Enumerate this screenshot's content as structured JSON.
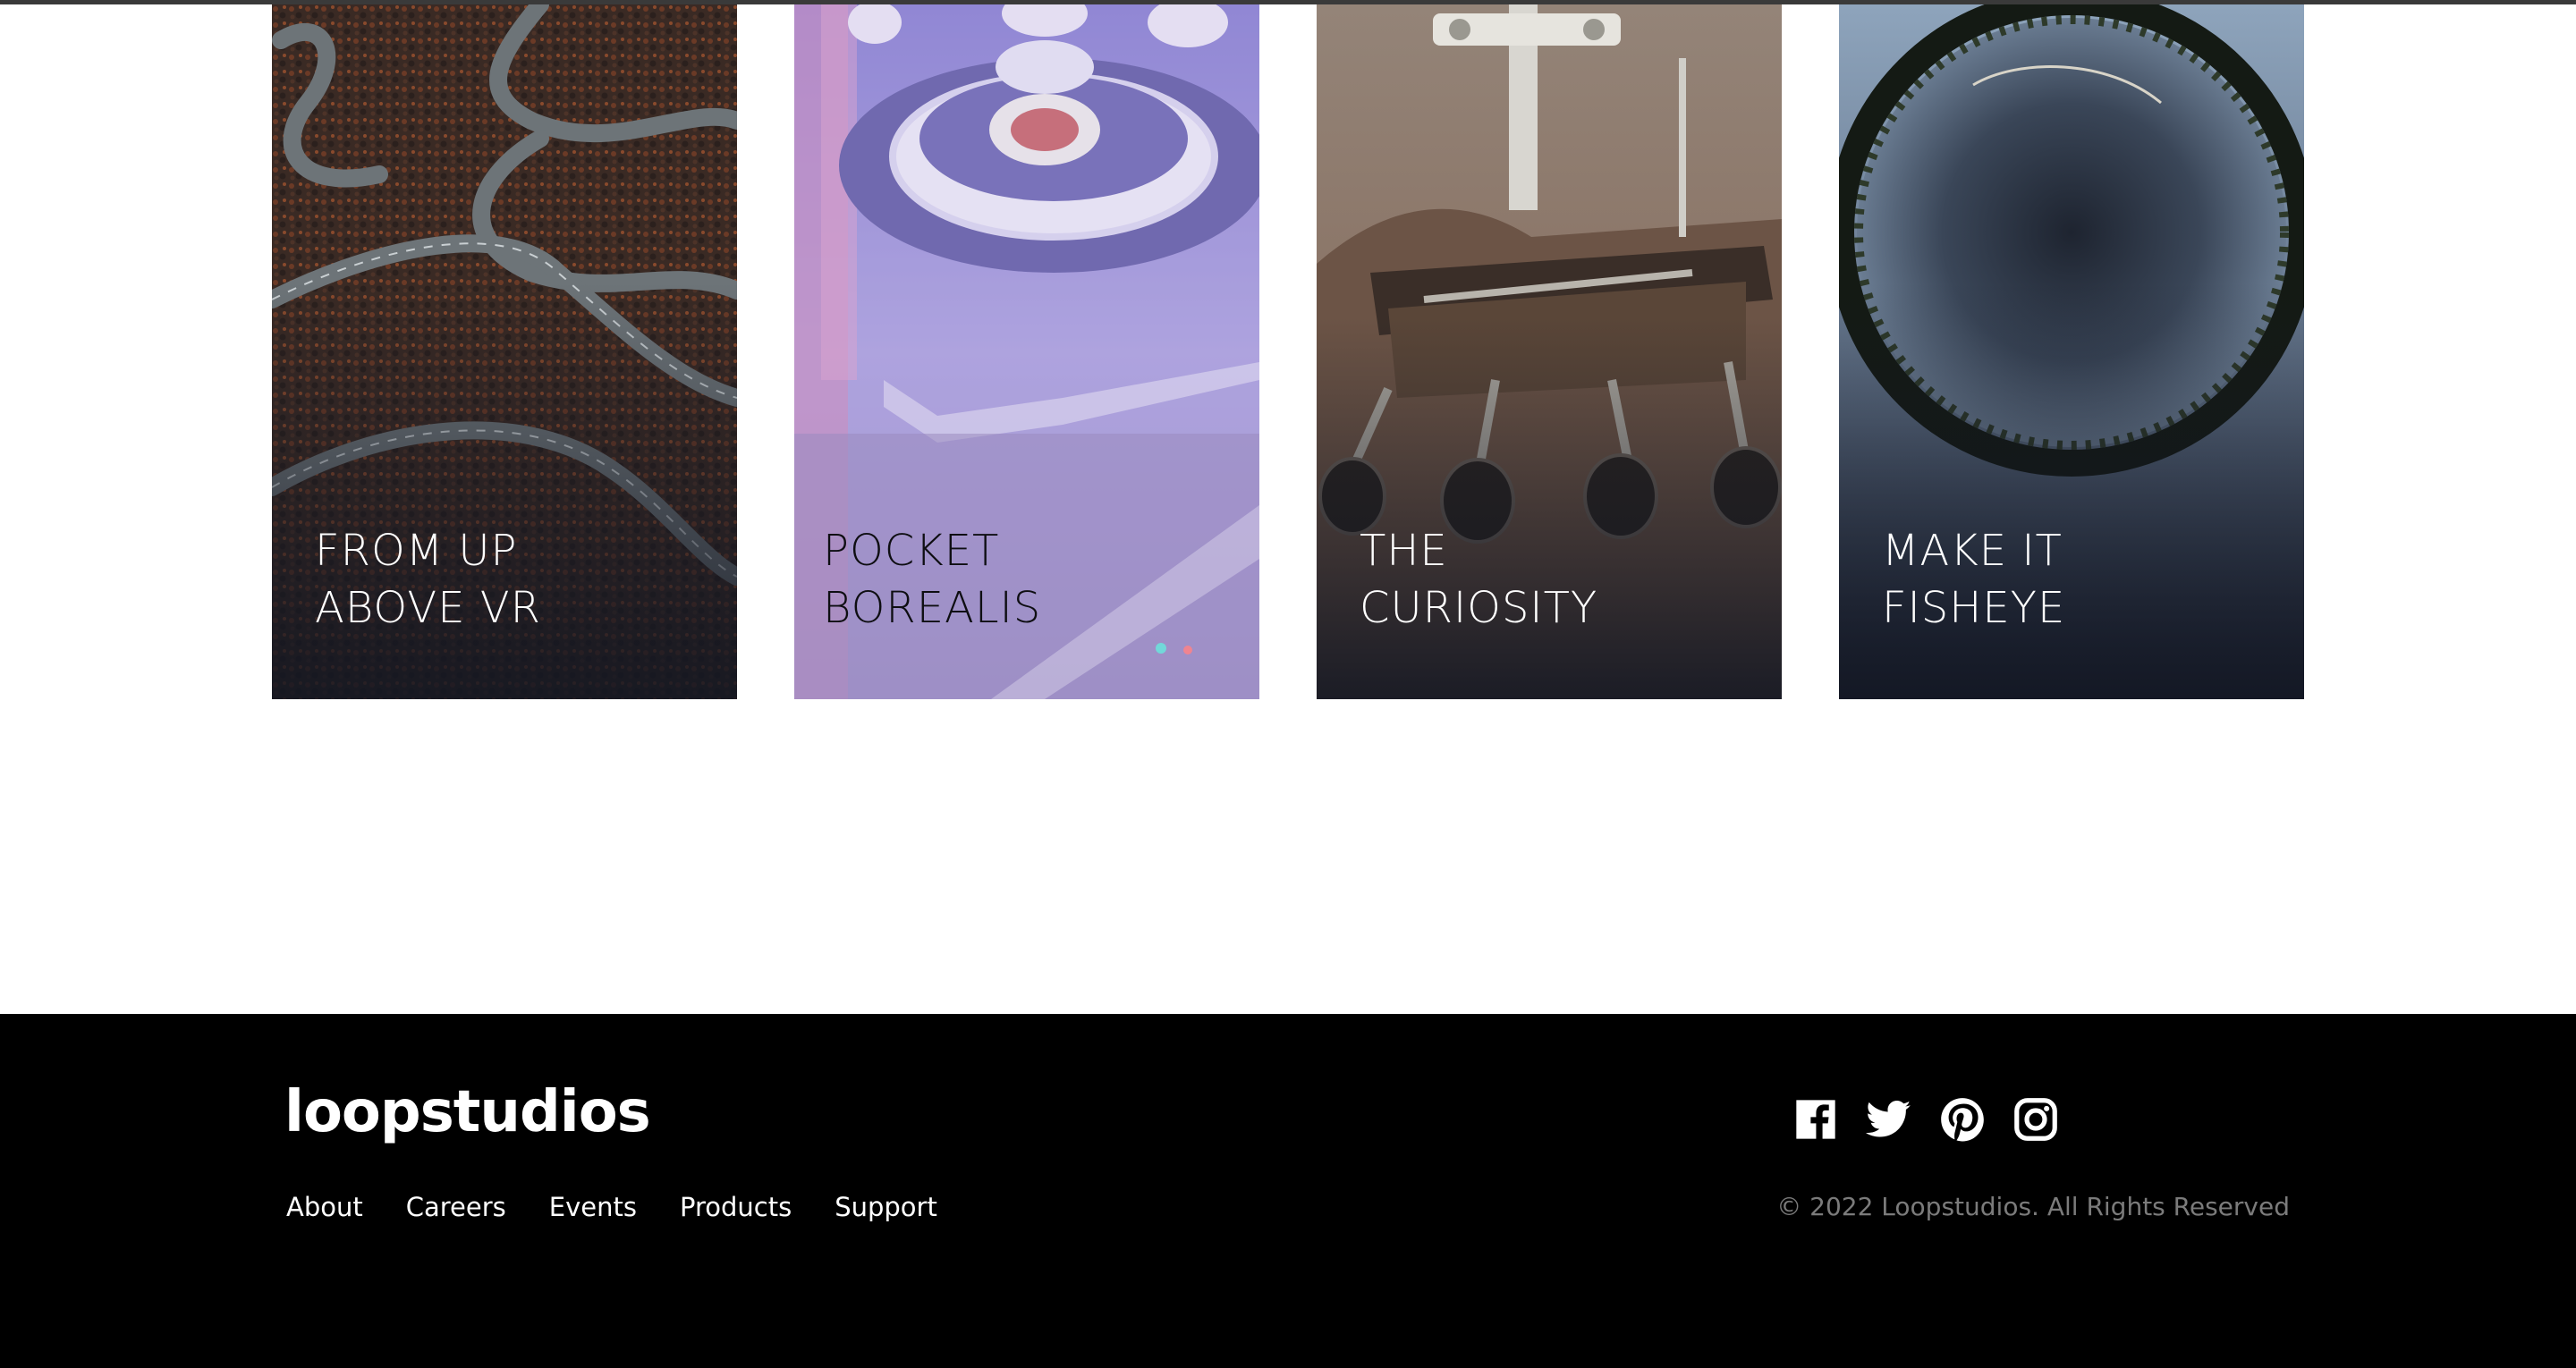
{
  "creations": {
    "items": [
      {
        "title_line1": "FROM UP",
        "title_line2": "ABOVE VR"
      },
      {
        "title_line1": "POCKET",
        "title_line2": "BOREALIS"
      },
      {
        "title_line1": "THE",
        "title_line2": "CURIOSITY"
      },
      {
        "title_line1": "MAKE IT",
        "title_line2": "FISHEYE"
      }
    ]
  },
  "footer": {
    "logo": "loopstudios",
    "nav": [
      "About",
      "Careers",
      "Events",
      "Products",
      "Support"
    ],
    "social_icons": [
      "facebook-icon",
      "twitter-icon",
      "pinterest-icon",
      "instagram-icon"
    ],
    "copyright": "© 2022 Loopstudios. All Rights Reserved"
  },
  "colors": {
    "footer_background": "#000000",
    "footer_text": "#ffffff",
    "copyright_text": "#7b7b7b",
    "page_background": "#ffffff"
  }
}
